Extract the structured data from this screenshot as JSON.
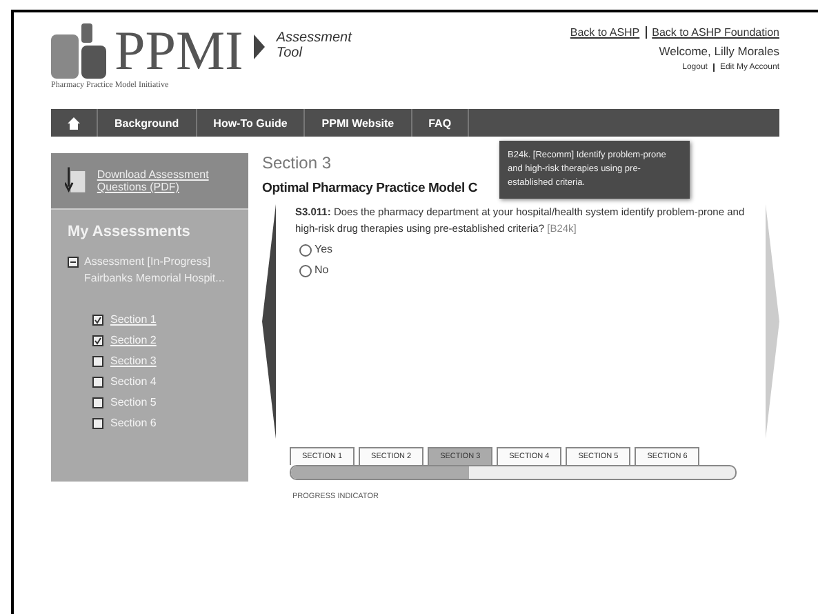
{
  "header": {
    "logo": "PPMI",
    "logo_subtitle": "Pharmacy Practice Model Initiative",
    "tool_name": "Assessment Tool",
    "links": [
      "Back to ASHP",
      "Back to ASHP Foundation"
    ],
    "welcome": "Welcome, Lilly Morales",
    "account_links": [
      "Logout",
      "Edit My Account"
    ]
  },
  "nav": {
    "items": [
      "Background",
      "How-To Guide",
      "PPMI Website",
      "FAQ"
    ]
  },
  "sidebar": {
    "download": "Download Assessment Questions (PDF)",
    "heading": "My Assessments",
    "assessment": {
      "expanded": true,
      "title": "Assessment [In-Progress]",
      "subtitle": "Fairbanks Memorial Hospit...",
      "children": [
        {
          "label": "Section 1",
          "checked": true,
          "link": true
        },
        {
          "label": "Section 2",
          "checked": true,
          "link": true
        },
        {
          "label": "Section 3",
          "checked": false,
          "link": true
        },
        {
          "label": "Section 4",
          "checked": false,
          "link": false
        },
        {
          "label": "Section 5",
          "checked": false,
          "link": false
        },
        {
          "label": "Section 6",
          "checked": false,
          "link": false
        }
      ]
    }
  },
  "main": {
    "section": "Section 3",
    "heading": "Optimal Pharmacy Practice Model C",
    "question_id": "S3.011:",
    "question": "Does the pharmacy department at your hospital/health system identify problem-prone and high-risk drug therapies using pre-established criteria?",
    "reference": "[B24k]",
    "options": [
      {
        "label": "Yes",
        "selected": false
      },
      {
        "label": "No",
        "selected": false
      }
    ],
    "tooltip": "B24k. [Recomm] Identify problem-prone and high-risk therapies using pre-established criteria.",
    "tabs": [
      {
        "label": "SECTION 1",
        "selected": false
      },
      {
        "label": "SECTION 2",
        "selected": false
      },
      {
        "label": "SECTION 3",
        "selected": true
      },
      {
        "label": "SECTION 4",
        "selected": false
      },
      {
        "label": "SECTION 5",
        "selected": false
      },
      {
        "label": "SECTION 6",
        "selected": false
      }
    ],
    "progress": {
      "level": 0.4,
      "label": "PROGRESS INDICATOR"
    }
  }
}
